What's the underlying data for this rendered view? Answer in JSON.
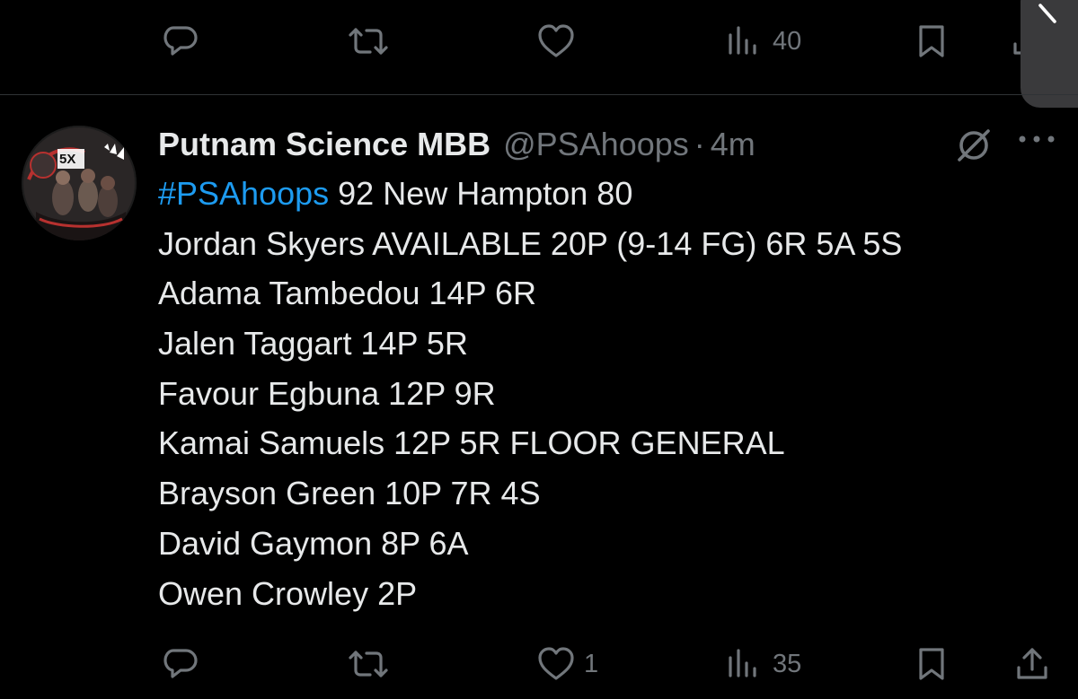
{
  "top_actions": {
    "views_count": "40"
  },
  "tweet": {
    "display_name": "Putnam Science MBB",
    "handle": "@PSAhoops",
    "separator": "·",
    "time": "4m",
    "hashtag": "#PSAhoops",
    "first_line_rest": " 92 New Hampton 80",
    "lines": [
      "Jordan Skyers AVAILABLE 20P (9-14 FG) 6R 5A 5S",
      "Adama Tambedou 14P 6R",
      "Jalen Taggart 14P 5R",
      "Favour Egbuna 12P 9R",
      "Kamai Samuels 12P 5R FLOOR GENERAL",
      "Brayson Green 10P 7R 4S",
      "David Gaymon 8P 6A",
      "Owen Crowley 2P"
    ]
  },
  "bottom_actions": {
    "likes_count": "1",
    "views_count": "35"
  },
  "icons": {
    "reply": "reply-icon",
    "retweet": "retweet-icon",
    "like": "heart-icon",
    "views": "views-icon",
    "bookmark": "bookmark-icon",
    "share": "share-icon",
    "grok": "grok-icon",
    "more": "more-icon"
  },
  "colors": {
    "background": "#000000",
    "text": "#e7e9ea",
    "muted": "#71767b",
    "link": "#1d9bf0",
    "divider": "#2f3336"
  }
}
